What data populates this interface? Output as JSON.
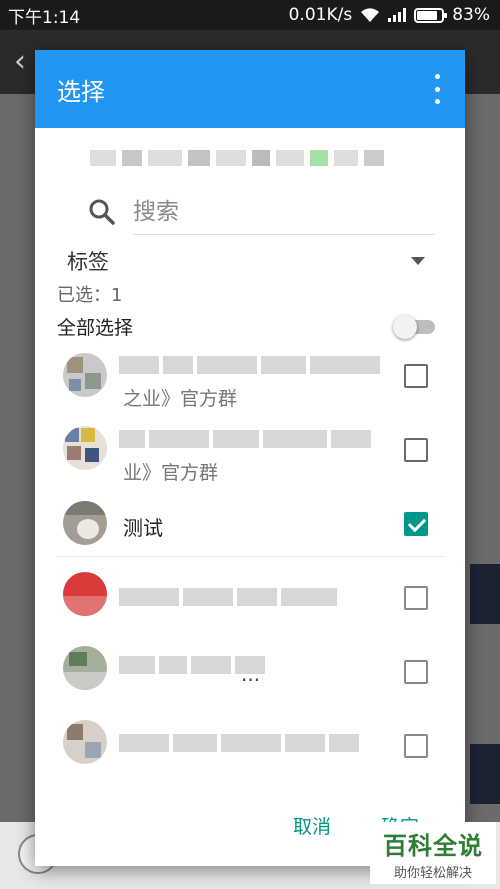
{
  "status_bar": {
    "time": "下午1:14",
    "network_speed": "0.01K/s",
    "battery_percent": "83%",
    "battery_level": 0.83,
    "icons": [
      "wifi-icon",
      "signal-icon",
      "battery-icon"
    ]
  },
  "background": {
    "back_icon": "back-arrow-icon"
  },
  "dialog": {
    "title": "选择",
    "menu_icon": "more-vert-icon",
    "search": {
      "placeholder": "搜索",
      "icon": "search-icon"
    },
    "tag": {
      "label": "标签",
      "dropdown_icon": "dropdown-caret-icon"
    },
    "selected_count": "已选：1",
    "select_all": {
      "label": "全部选择",
      "enabled": false
    },
    "items": [
      {
        "name": "",
        "name_suffix": "之业》官方群",
        "checked": false
      },
      {
        "name": "",
        "name_suffix": "业》官方群",
        "checked": false
      },
      {
        "name": "测试",
        "checked": true
      },
      {
        "name": "",
        "checked": false
      },
      {
        "name": "",
        "trailing": "...",
        "checked": false
      },
      {
        "name": "",
        "checked": false
      }
    ],
    "actions": {
      "cancel": "取消",
      "confirm": "确定"
    }
  },
  "colors": {
    "header": "#2196f3",
    "accent": "#009688",
    "switch_track": "#bdbdbd"
  },
  "watermark": {
    "title": "百科全说",
    "subtitle": "助你轻松解决"
  }
}
